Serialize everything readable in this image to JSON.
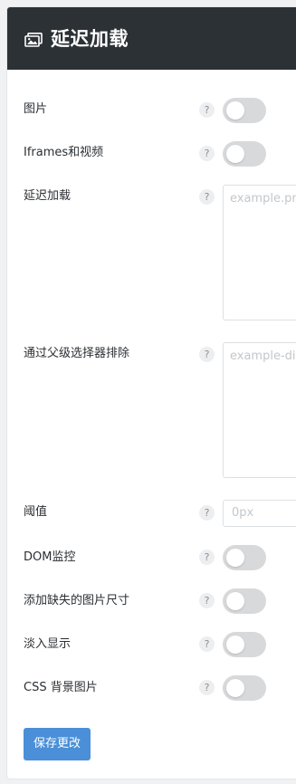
{
  "header": {
    "title": "延迟加载",
    "icon": "images-icon"
  },
  "settings": [
    {
      "label": "图片",
      "help": "?",
      "type": "toggle",
      "enabled": false
    },
    {
      "label": "Iframes和视频",
      "help": "?",
      "type": "toggle",
      "enabled": false
    },
    {
      "label": "延迟加载",
      "help": "?",
      "type": "textarea",
      "placeholder": "example.png"
    },
    {
      "label": "通过父级选择器排除",
      "help": "?",
      "type": "textarea",
      "placeholder": "example-div"
    },
    {
      "label": "阈值",
      "help": "?",
      "type": "input",
      "placeholder": "0px"
    },
    {
      "label": "DOM监控",
      "help": "?",
      "type": "toggle",
      "enabled": false
    },
    {
      "label": "添加缺失的图片尺寸",
      "help": "?",
      "type": "toggle",
      "enabled": false
    },
    {
      "label": "淡入显示",
      "help": "?",
      "type": "toggle",
      "enabled": false
    },
    {
      "label": "CSS 背景图片",
      "help": "?",
      "type": "toggle",
      "enabled": false
    }
  ],
  "save_button": {
    "label": "保存更改"
  },
  "colors": {
    "header_bg": "#2c3136",
    "accent": "#4a8fd8",
    "toggle_off": "#d8d9db"
  }
}
